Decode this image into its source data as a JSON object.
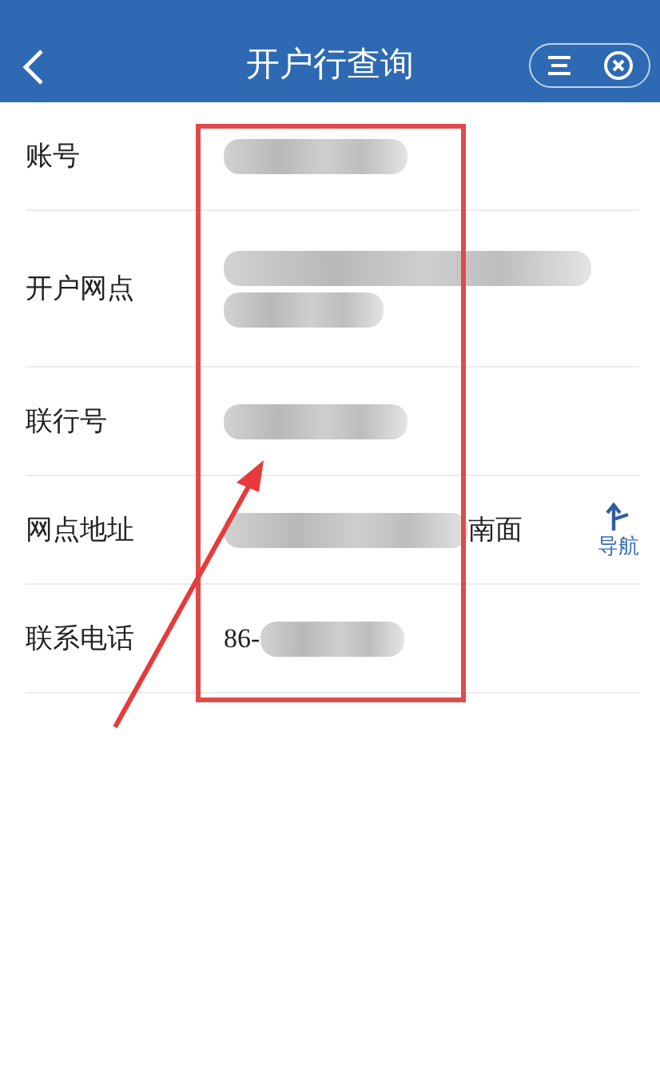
{
  "header": {
    "title": "开户行查询"
  },
  "rows": [
    {
      "label": "账号",
      "kind": "masked"
    },
    {
      "label": "开户网点",
      "kind": "masked-two-line"
    },
    {
      "label": "联行号",
      "kind": "masked"
    },
    {
      "label": "网点地址",
      "kind": "masked",
      "suffix": "南面",
      "action": "导航"
    },
    {
      "label": "联系电话",
      "kind": "masked",
      "prefix": "86-"
    }
  ]
}
